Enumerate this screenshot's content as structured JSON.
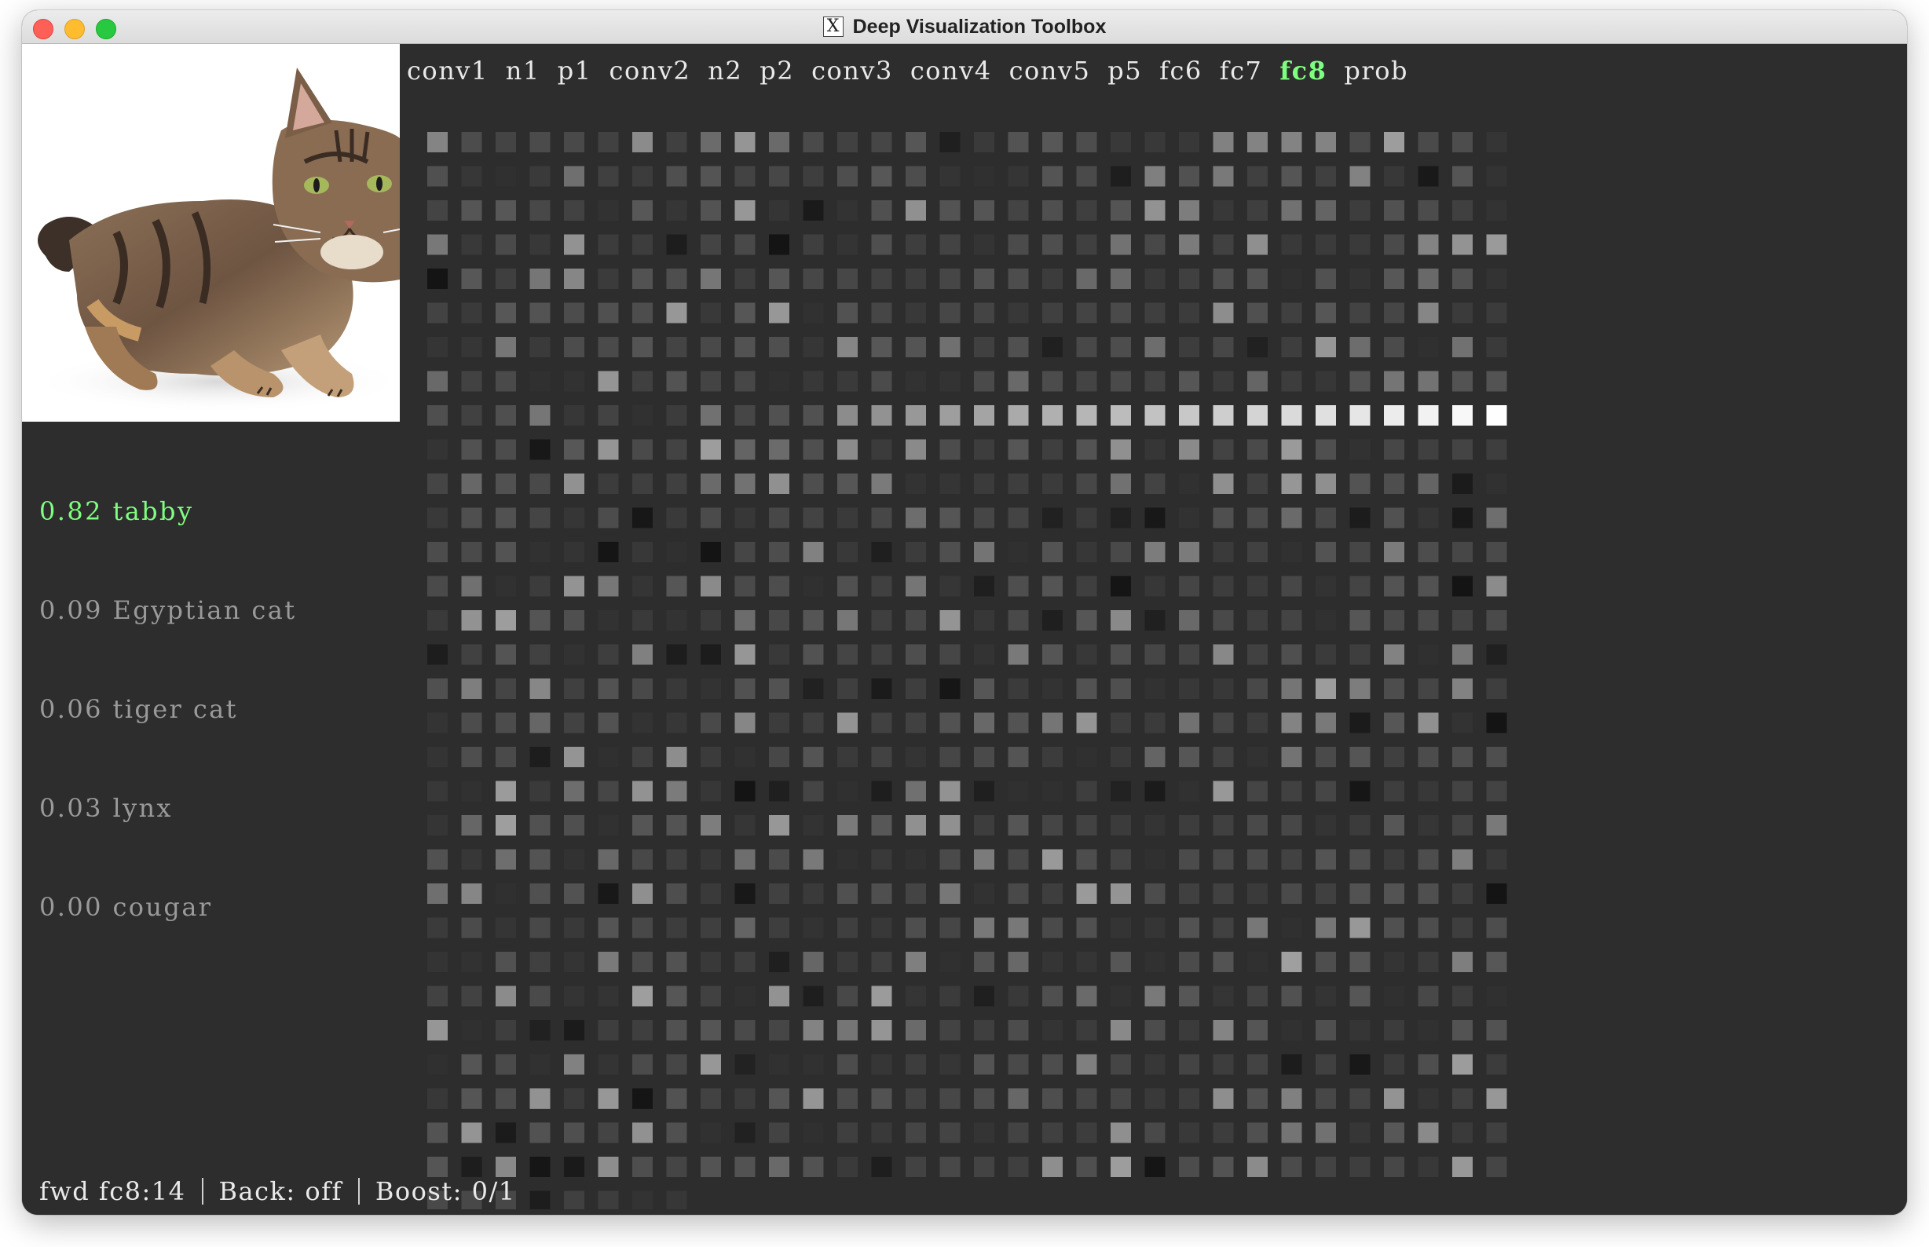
{
  "window": {
    "title": "Deep Visualization Toolbox",
    "app_icon": "x11-icon"
  },
  "input_image": {
    "icon": "cat-photo",
    "alt": "tabby cat lying down"
  },
  "layers": [
    "conv1",
    "n1",
    "p1",
    "conv2",
    "n2",
    "p2",
    "conv3",
    "conv4",
    "conv5",
    "p5",
    "fc6",
    "fc7",
    "fc8",
    "prob"
  ],
  "selected_layer": "fc8",
  "predictions": [
    {
      "prob": "0.82",
      "label": "tabby"
    },
    {
      "prob": "0.09",
      "label": "Egyptian cat"
    },
    {
      "prob": "0.06",
      "label": "tiger cat"
    },
    {
      "prob": "0.03",
      "label": "lynx"
    },
    {
      "prob": "0.00",
      "label": "cougar"
    }
  ],
  "status": {
    "mode": "fwd fc8:14",
    "back": "Back: off",
    "boost": "Boost: 0/1"
  },
  "activation_grid": {
    "columns": 32,
    "rows": 32,
    "last_row_cells": 8,
    "highlight_row": 8,
    "colors": {
      "background": "#2d2d2d",
      "selected": "#7fff7f",
      "text": "#e9e9e9",
      "muted": "#9a9a9a"
    }
  }
}
